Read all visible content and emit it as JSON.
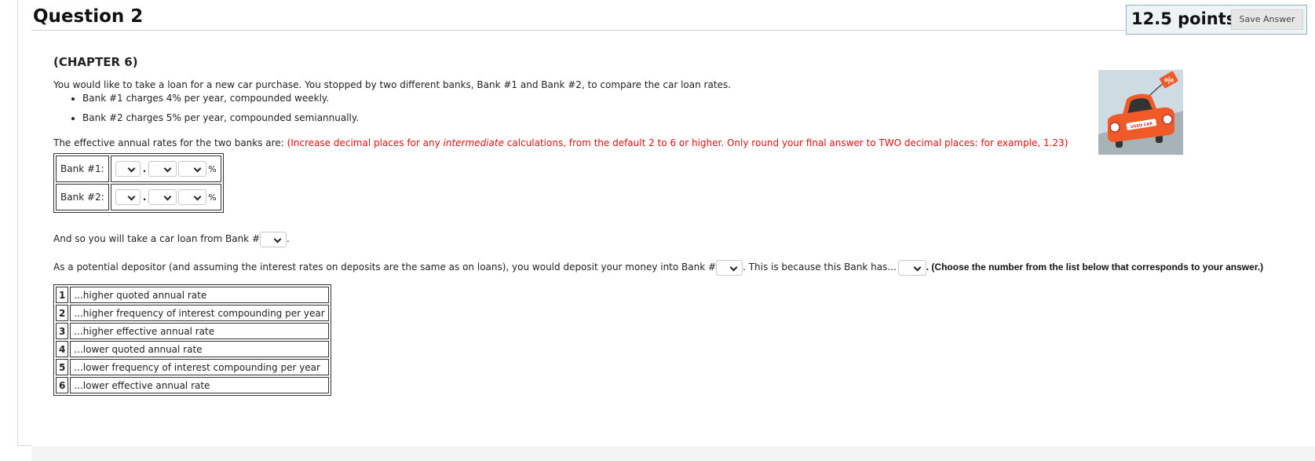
{
  "header": {
    "title": "Question 2",
    "points": "12.5 points",
    "save_label": "Save Answer"
  },
  "question": {
    "chapter": "(CHAPTER 6)",
    "intro": "You would like to take a loan for a new car purchase. You stopped by two different banks, Bank #1 and Bank #2, to compare the car loan rates.",
    "bullets": [
      "Bank #1 charges 4% per year, compounded weekly.",
      "Bank #2 charges 5% per year, compounded semiannually."
    ],
    "effective_lead": "The effective annual rates for the two banks are: ",
    "red_note_a": "(Increase decimal places for any ",
    "red_note_em": "intermediate",
    "red_note_b": " calculations, from the default 2 to 6 or higher. Only round your final answer to TWO decimal places: for example, 1.23)",
    "rates": [
      {
        "label": "Bank #1:",
        "unit": "%"
      },
      {
        "label": "Bank #2:",
        "unit": "%"
      }
    ],
    "take_loan_prefix": "And so you will take a car loan from Bank #",
    "take_loan_suffix": ".",
    "deposit_prefix": "As a potential depositor (and assuming the interest rates on deposits are the same as on loans), you would deposit your money into Bank #",
    "deposit_mid": ". This is because this Bank has...",
    "deposit_note": ". (Choose the number from the list below that corresponds to your answer.)",
    "choices": [
      {
        "num": "1",
        "text": "...higher quoted annual rate"
      },
      {
        "num": "2",
        "text": "...higher frequency of interest compounding per year"
      },
      {
        "num": "3",
        "text": "...higher effective annual rate"
      },
      {
        "num": "4",
        "text": "...lower quoted annual rate"
      },
      {
        "num": "5",
        "text": "...lower frequency of interest compounding per year"
      },
      {
        "num": "6",
        "text": "...lower effective annual rate"
      }
    ],
    "image": {
      "tag_text": "%",
      "plate_text": "USED CAR"
    }
  },
  "colors": {
    "red_note": "#dd1111",
    "car": "#f05a28",
    "road": "#a8b3b8",
    "sky": "#cfdbe2"
  }
}
